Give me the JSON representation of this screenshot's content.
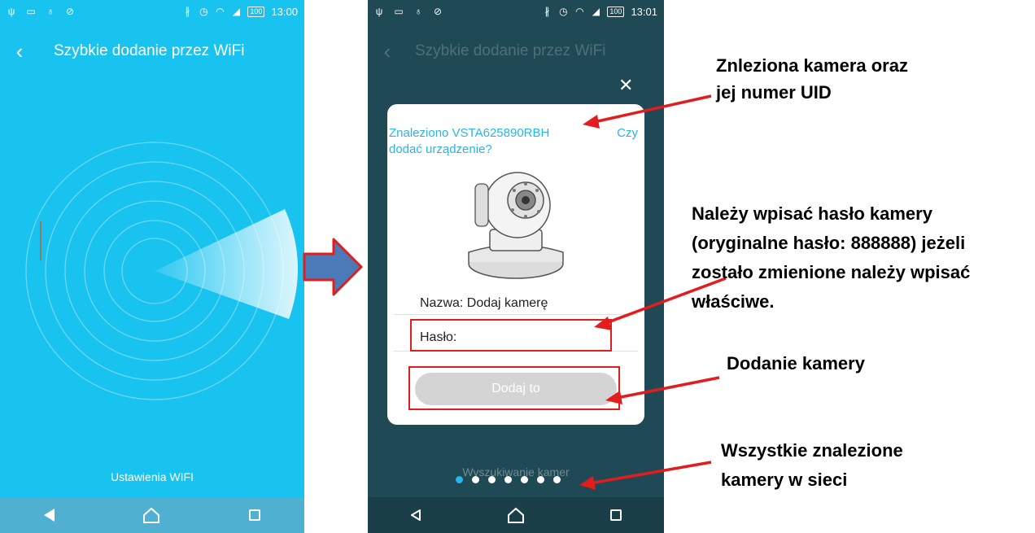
{
  "phone1": {
    "status": {
      "battery": "100",
      "time": "13:00"
    },
    "title": "Szybkie dodanie przez WiFi",
    "wifi_settings_label": "Ustawienia WIFI"
  },
  "phone2": {
    "status": {
      "battery": "100",
      "time": "13:01"
    },
    "title": "Szybkie dodanie przez WiFi",
    "found_line1": "Znaleziono VSTA625890RBH",
    "found_czy": "Czy",
    "found_line2": "dodać urządzenie?",
    "name_label": "Nazwa: Dodaj kamerę",
    "password_label": "Hasło:",
    "add_button_label": "Dodaj to",
    "searching_label": "Wyszukiwanie kamer",
    "close_symbol": "✕",
    "page_count": 7,
    "active_page": 1
  },
  "annotations": {
    "uid_line1": "Znleziona kamera oraz",
    "uid_line2": "jej numer UID",
    "pwd_line1": "Należy wpisać hasło kamery",
    "pwd_line2": "(oryginalne hasło: 888888) jeżeli",
    "pwd_line3": "zostało zmienione należy wpisać",
    "pwd_line4": "właściwe.",
    "add_label": "Dodanie kamery",
    "all_line1": "Wszystkie znalezione",
    "all_line2": "kamery w sieci"
  },
  "colors": {
    "phone1_bg": "#19c3f0",
    "phone1_nav": "#4fb0d1",
    "phone2_bg": "#1f4954",
    "accent": "#27b5ea",
    "annotation_red": "#e11d1d",
    "arrow_blue": "#4a7ab8"
  },
  "icons": [
    "usb-icon",
    "image-icon",
    "lightbulb-icon",
    "blocked-icon",
    "bluetooth-icon",
    "alarm-icon",
    "wifi-icon",
    "signal-icon",
    "battery-icon",
    "back-arrow-icon",
    "close-icon",
    "nav-back-icon",
    "nav-home-icon",
    "nav-recent-icon"
  ]
}
